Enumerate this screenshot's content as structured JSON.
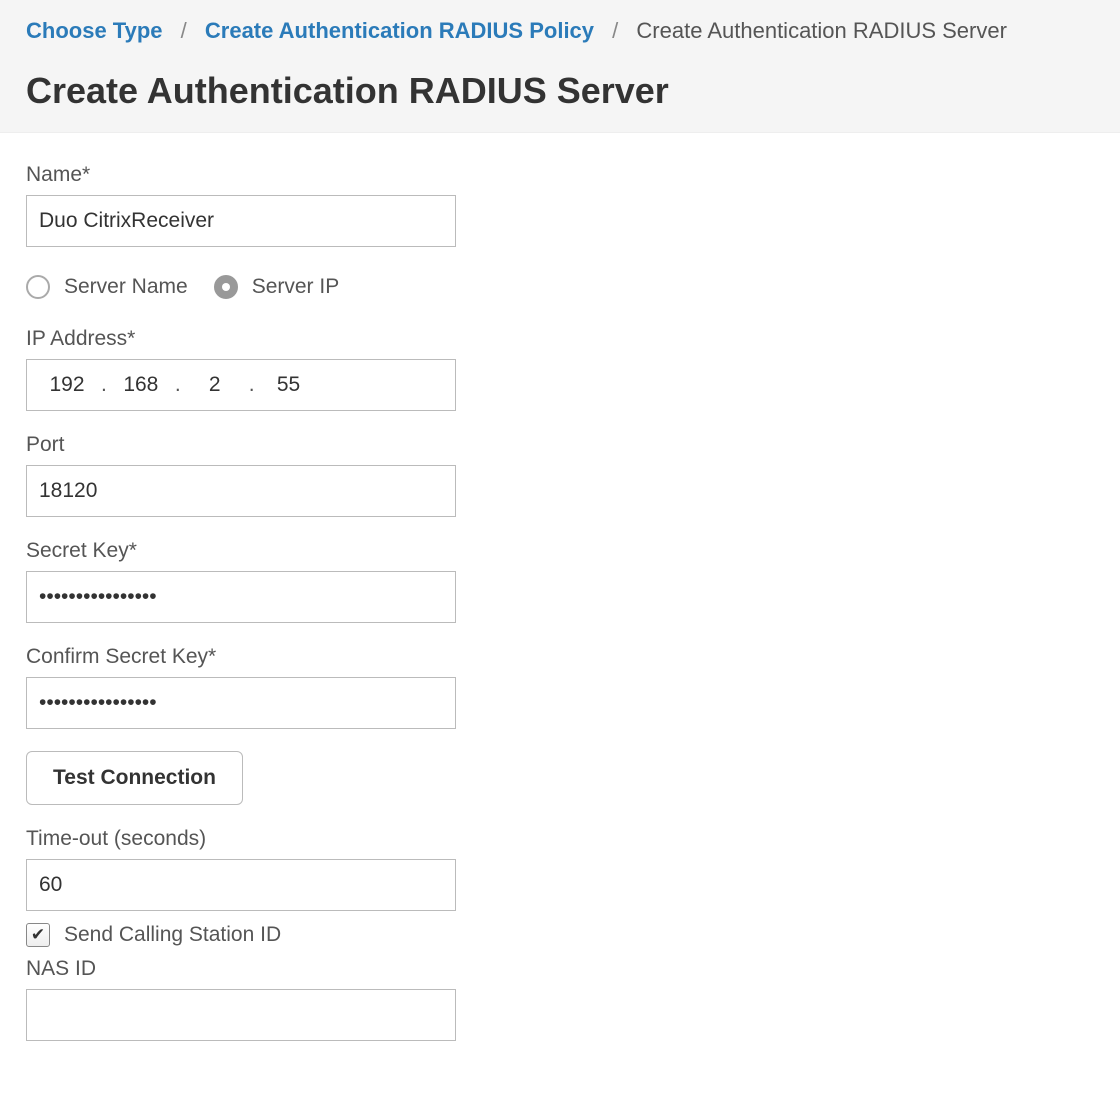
{
  "breadcrumb": {
    "items": [
      {
        "label": "Choose Type",
        "link": true
      },
      {
        "label": "Create Authentication RADIUS Policy",
        "link": true
      },
      {
        "label": "Create Authentication RADIUS Server",
        "link": false
      }
    ]
  },
  "page_title": "Create Authentication RADIUS Server",
  "form": {
    "name_label": "Name*",
    "name_value": "Duo CitrixReceiver",
    "server_mode": {
      "server_name_label": "Server Name",
      "server_ip_label": "Server IP",
      "selected": "server_ip"
    },
    "ip_label": "IP Address*",
    "ip_octets": [
      "192",
      "168",
      "2",
      "55"
    ],
    "port_label": "Port",
    "port_value": "18120",
    "secret_label": "Secret Key*",
    "secret_value": "••••••••••••••••",
    "confirm_secret_label": "Confirm Secret Key*",
    "confirm_secret_value": "••••••••••••••••",
    "test_connection_label": "Test Connection",
    "timeout_label": "Time-out (seconds)",
    "timeout_value": "60",
    "send_calling_station_label": "Send Calling Station ID",
    "send_calling_station_checked": true,
    "nas_id_label": "NAS ID",
    "nas_id_value": ""
  }
}
